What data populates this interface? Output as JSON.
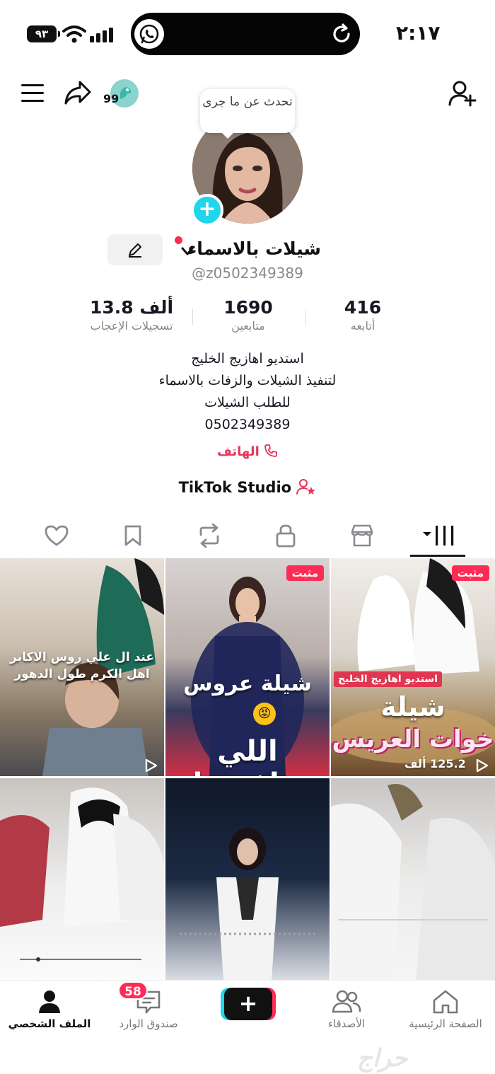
{
  "status_bar": {
    "time": "٢:١٧",
    "battery": "٩٣"
  },
  "header": {
    "bubble": "تحدث عن ما جرى",
    "badge": "99"
  },
  "profile": {
    "name": "شيلات بالاسماء",
    "handle": "@z0502349389",
    "stats": [
      {
        "value": "416",
        "label": "أتابعه"
      },
      {
        "value": "1690",
        "label": "متابعين"
      },
      {
        "value": "13.8 ألف",
        "label": "تسجيلات الإعجاب"
      }
    ],
    "bio": [
      "استديو اهازيج الخليج",
      "لتنفيذ الشيلات والزفات بالاسماء",
      "للطلب الشيلات",
      "0502349389"
    ],
    "phone_label": "الهاتف",
    "studio_label": "TikTok Studio"
  },
  "tabs": [
    "videos",
    "shop",
    "private",
    "reposts",
    "favorites",
    "liked"
  ],
  "videos": [
    {
      "pinned": "مثبت",
      "badge": "استديو اهازيج الخليج",
      "title1": "شيلة",
      "title2": "خوات العريس",
      "views": "125.2 ألف"
    },
    {
      "pinned": "مثبت",
      "title1": "شيلة عروس",
      "title2": "اللي ينافسها"
    },
    {
      "caption1": "عند ال علي روس الاكابر",
      "caption2": "اهل الكرم طول الدهور"
    },
    {},
    {},
    {}
  ],
  "nav": {
    "home": "الصفحة الرئيسية",
    "friends": "الأصدقاء",
    "inbox": "صندوق الوارد",
    "inbox_badge": "58",
    "profile": "الملف الشخصي"
  },
  "watermark": "حراج",
  "colors": {
    "accent": "#fe2c55",
    "cyan": "#20d5ec",
    "text": "#161823",
    "muted": "#888888"
  }
}
